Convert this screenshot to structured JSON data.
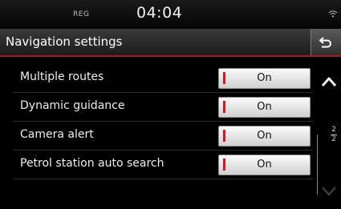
{
  "status_bar": {
    "reg": "REG",
    "clock": "04:04",
    "icon": "signal-icon"
  },
  "header": {
    "title": "Navigation settings",
    "back_icon": "back-arrow-icon"
  },
  "settings": [
    {
      "label": "Multiple routes",
      "value": "On"
    },
    {
      "label": "Dynamic guidance",
      "value": "On"
    },
    {
      "label": "Camera alert",
      "value": "On"
    },
    {
      "label": "Petrol station auto search",
      "value": "On"
    }
  ],
  "scroll": {
    "page_current": "2",
    "page_total": "2",
    "up_icon": "chevron-up-icon",
    "down_icon": "chevron-down-icon"
  },
  "colors": {
    "accent_red": "#d8161b",
    "background": "#000000"
  }
}
